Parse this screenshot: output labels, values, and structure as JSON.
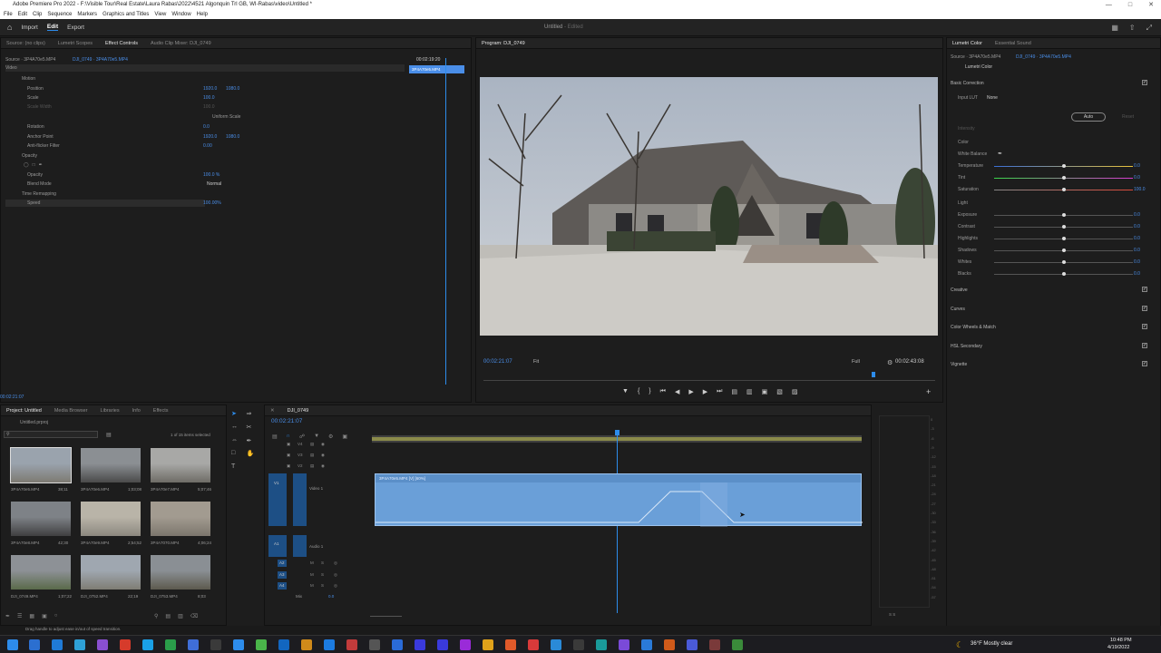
{
  "window": {
    "title": "Adobe Premiere Pro 2022 - F:\\Visible Tour\\Real Estate\\Laura Rabas\\2022\\4521 Algonquin Trl GB, WI-Rabas\\video\\Untitled *"
  },
  "menu": [
    "File",
    "Edit",
    "Clip",
    "Sequence",
    "Markers",
    "Graphics and Titles",
    "View",
    "Window",
    "Help"
  ],
  "nav": {
    "import": "Import",
    "edit": "Edit",
    "export": "Export",
    "project_title": "Untitled",
    "project_status": "- Edited"
  },
  "source_tabs": [
    "Source: (no clips)",
    "Lumetri Scopes",
    "Effect Controls",
    "Audio Clip Mixer: DJI_0749"
  ],
  "effect_controls": {
    "source_label": "Source · 3P4A70e5.MP4",
    "clip_label": "DJI_0749 · 3P4A70e5.MP4",
    "timecode": "00:02:19:20",
    "mini_clip": "3P4A70e5.MP4",
    "video_header": "Video",
    "motion": "Motion",
    "position": "Position",
    "pos_x": "1920.0",
    "pos_y": "1080.0",
    "scale": "Scale",
    "scale_val": "100.0",
    "scale_width": "Scale Width",
    "scale_width_val": "100.0",
    "uniform_scale": "Uniform Scale",
    "rotation": "Rotation",
    "rotation_val": "0.0",
    "anchor": "Anchor Point",
    "anchor_x": "1920.0",
    "anchor_y": "1080.0",
    "antiflicker": "Anti-flicker Filter",
    "antiflicker_val": "0.00",
    "opacity_group": "Opacity",
    "opacity": "Opacity",
    "opacity_val": "100.0 %",
    "blend": "Blend Mode",
    "blend_val": "Normal",
    "time_remap": "Time Remapping",
    "speed": "Speed",
    "speed_val": "100.00%",
    "bottom_tc": "00:02:21:07"
  },
  "program": {
    "title": "Program: DJI_0749",
    "timecode": "00:02:21:07",
    "fit": "Fit",
    "full": "Full",
    "duration": "00:02:43:08"
  },
  "lumetri": {
    "tabs": [
      "Lumetri Color",
      "Essential Sound"
    ],
    "source": "Source · 3P4A70e5.MP4",
    "clip": "DJI_0749 · 3P4A70e5.MP4",
    "effect": "Lumetri Color",
    "basic": "Basic Correction",
    "input_lut": "Input LUT",
    "lut_val": "None",
    "intensity": "Intensity",
    "auto": "Auto",
    "reset": "Reset",
    "color": "Color",
    "white_balance": "White Balance",
    "color_sliders": [
      {
        "label": "Temperature",
        "value": "0.0"
      },
      {
        "label": "Tint",
        "value": "0.0"
      },
      {
        "label": "Saturation",
        "value": "100.0"
      }
    ],
    "light": "Light",
    "light_sliders": [
      {
        "label": "Exposure",
        "value": "0.0"
      },
      {
        "label": "Contrast",
        "value": "0.0"
      },
      {
        "label": "Highlights",
        "value": "0.0"
      },
      {
        "label": "Shadows",
        "value": "0.0"
      },
      {
        "label": "Whites",
        "value": "0.0"
      },
      {
        "label": "Blacks",
        "value": "0.0"
      }
    ],
    "sections": [
      "Creative",
      "Curves",
      "Color Wheels & Match",
      "HSL Secondary",
      "Vignette"
    ]
  },
  "project": {
    "tabs": [
      "Project: Untitled",
      "Media Browser",
      "Libraries",
      "Info",
      "Effects"
    ],
    "file": "Untitled.prproj",
    "count": "1 of 15 items selected",
    "items": [
      {
        "name": "3P4A70e5.MP4",
        "dur": "38;11"
      },
      {
        "name": "3P4A70e6.MP4",
        "dur": "1;03;08"
      },
      {
        "name": "3P4A70e7.MP4",
        "dur": "5;07;46"
      },
      {
        "name": "3P4A70e8.MP4",
        "dur": "42;30"
      },
      {
        "name": "3P4A70e9.MP4",
        "dur": "2;54;52"
      },
      {
        "name": "3P4A7070.MP4",
        "dur": "4;06;24"
      },
      {
        "name": "DJI_0749.MP4",
        "dur": "1;07;22"
      },
      {
        "name": "DJI_0752.MP4",
        "dur": "22;19"
      },
      {
        "name": "DJI_0753.MP4",
        "dur": "8;03"
      }
    ]
  },
  "timeline": {
    "seq": "DJI_0749",
    "timecode": "00:02:21:07",
    "clip": "3P4A70e5.MP4 [V] [60%]",
    "tracks_v": [
      "V4",
      "V3",
      "V2",
      "V1"
    ],
    "video1": "Video 1",
    "tracks_a": [
      "A1",
      "A2",
      "A3",
      "A4"
    ],
    "audio1": "Audio 1",
    "mix": "Mix",
    "mix_val": "0.0"
  },
  "meter_scale": [
    "0",
    "-3",
    "-6",
    "-9",
    "-12",
    "-15",
    "-18",
    "-21",
    "-24",
    "-27",
    "-30",
    "-33",
    "-36",
    "-39",
    "-42",
    "-45",
    "-48",
    "-51",
    "-54",
    "-57"
  ],
  "meter_ss": "S  S",
  "status": "Drag handle to adjust ease in/out of speed transition.",
  "taskbar": {
    "weather": "36°F  Mostly clear",
    "time": "10:48 PM",
    "date": "4/19/2022"
  },
  "colors": {
    "accent": "#2d8ceb",
    "clip": "#6a9fd8",
    "timecode": "#4a8ee8"
  }
}
